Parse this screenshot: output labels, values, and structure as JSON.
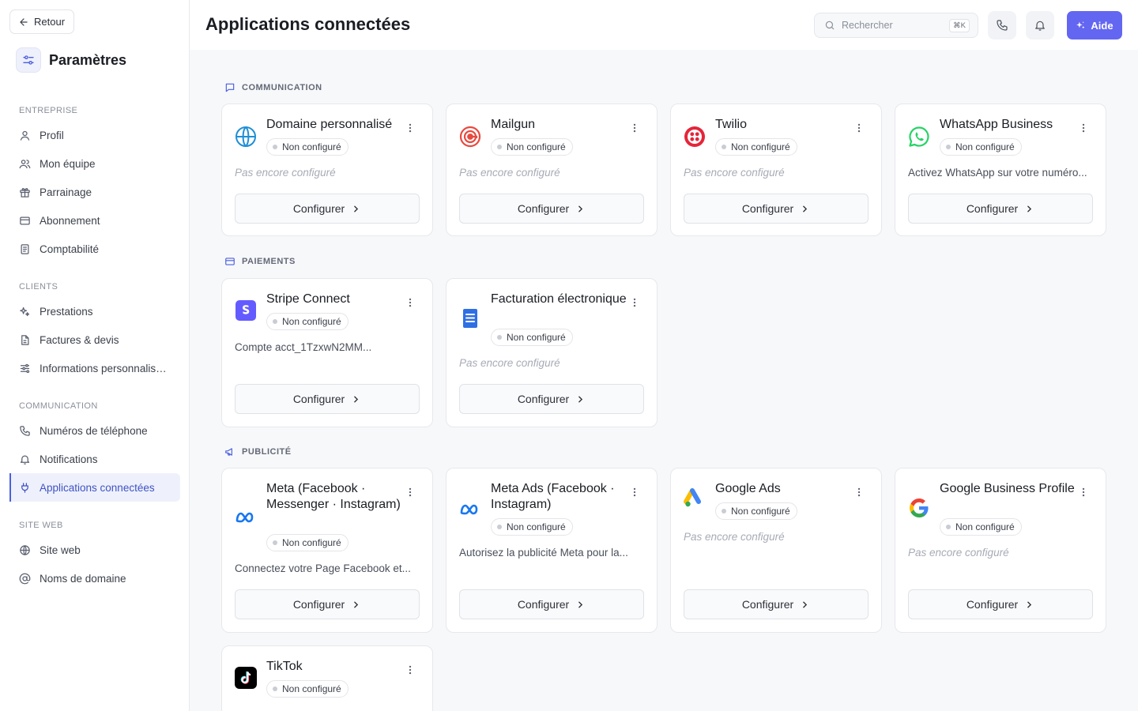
{
  "sidebar": {
    "back_label": "Retour",
    "title": "Paramètres",
    "sections": [
      {
        "label": "Entreprise",
        "items": [
          "Profil",
          "Mon équipe",
          "Parrainage",
          "Abonnement",
          "Comptabilité"
        ]
      },
      {
        "label": "Clients",
        "items": [
          "Prestations",
          "Factures & devis",
          "Informations personnalisées"
        ]
      },
      {
        "label": "Communication",
        "items": [
          "Numéros de téléphone",
          "Notifications",
          "Applications connectées"
        ]
      },
      {
        "label": "Site web",
        "items": [
          "Site web",
          "Noms de domaine"
        ]
      }
    ],
    "active_item": "Applications connectées"
  },
  "header": {
    "title": "Applications connectées",
    "search_placeholder": "Rechercher",
    "search_shortcut": "⌘K",
    "help_label": "Aide"
  },
  "colors": {
    "accent": "#6366f1",
    "active_nav": "#3f52c6"
  },
  "status_label": "Non configuré",
  "configure_label": "Configurer",
  "sections": [
    {
      "label": "Communication",
      "icon": "chat-icon",
      "cards": [
        {
          "name": "Domaine personnalisé",
          "icon": "globe-icon",
          "desc": "Pas encore configuré",
          "empty": true
        },
        {
          "name": "Mailgun",
          "icon": "mailgun-icon",
          "desc": "Pas encore configuré",
          "empty": true
        },
        {
          "name": "Twilio",
          "icon": "twilio-icon",
          "desc": "Pas encore configuré",
          "empty": true
        },
        {
          "name": "WhatsApp Business",
          "icon": "whatsapp-icon",
          "desc": "Activez WhatsApp sur votre numéro...",
          "empty": false
        }
      ]
    },
    {
      "label": "Paiements",
      "icon": "credit-card-icon",
      "cards": [
        {
          "name": "Stripe Connect",
          "icon": "stripe-icon",
          "desc": "Compte acct_1TzxwN2MM...",
          "empty": false
        },
        {
          "name": "Facturation électronique",
          "icon": "document-icon",
          "desc": "Pas encore configuré",
          "empty": true
        }
      ]
    },
    {
      "label": "Publicité",
      "icon": "megaphone-icon",
      "cards": [
        {
          "name": "Meta (Facebook · Messenger · Instagram)",
          "icon": "meta-icon",
          "desc": "Connectez votre Page Facebook et...",
          "empty": false
        },
        {
          "name": "Meta Ads (Facebook · Instagram)",
          "icon": "meta-icon",
          "desc": "Autorisez la publicité Meta pour la...",
          "empty": false
        },
        {
          "name": "Google Ads",
          "icon": "google-ads-icon",
          "desc": "Pas encore configuré",
          "empty": true
        },
        {
          "name": "Google Business Profile",
          "icon": "google-icon",
          "desc": "Pas encore configuré",
          "empty": true
        },
        {
          "name": "TikTok",
          "icon": "tiktok-icon",
          "desc": "",
          "empty": true
        }
      ]
    }
  ]
}
